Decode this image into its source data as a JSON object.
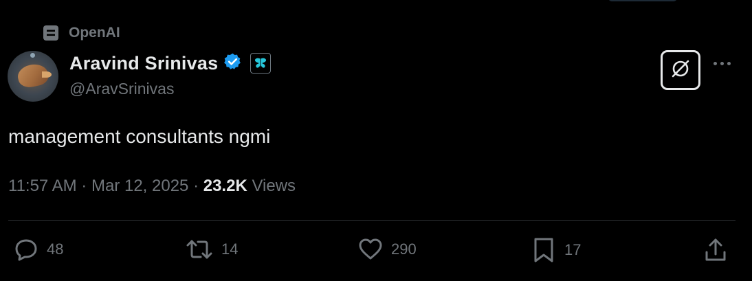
{
  "context": {
    "label": "OpenAI",
    "icon": "organization-icon"
  },
  "author": {
    "name": "Aravind Srinivas",
    "handle": "@AravSrinivas",
    "verified_icon": "verified-badge-icon",
    "affiliation_icon": "affiliation-badge-icon"
  },
  "header_actions": {
    "grok_icon": "grok-icon",
    "more_icon": "more-options-icon"
  },
  "tweet": {
    "text": "management consultants ngmi",
    "time": "11:57 AM",
    "separator": "·",
    "date": "Mar 12, 2025",
    "views_count": "23.2K",
    "views_label": "Views"
  },
  "actions": {
    "replies": "48",
    "reposts": "14",
    "likes": "290",
    "bookmarks": "17"
  },
  "colors": {
    "background": "#000000",
    "text": "#e7e9ea",
    "muted": "#71767b",
    "verified": "#1d9bf0",
    "divider": "#2f3336"
  }
}
